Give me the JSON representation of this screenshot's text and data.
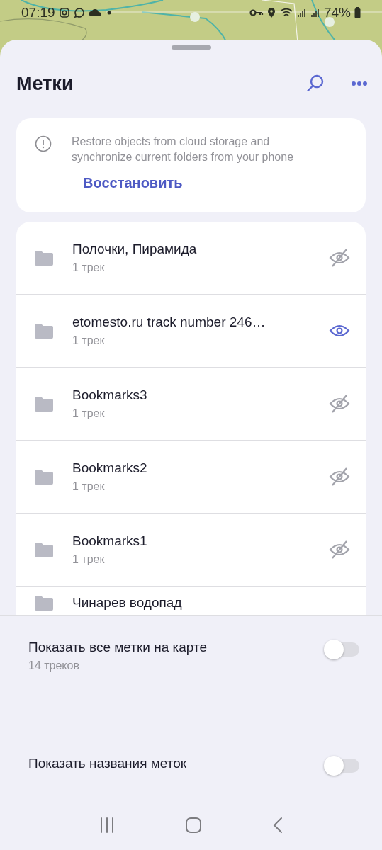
{
  "status_bar": {
    "time": "07:19",
    "battery": "74%"
  },
  "header": {
    "title": "Метки"
  },
  "sync_card": {
    "message": "Restore objects from cloud storage and synchronize current folders from your phone",
    "action": "Восстановить"
  },
  "lists": [
    {
      "name": "Полочки, Пирамида",
      "count": "1 трек",
      "visible": false
    },
    {
      "name": "etomesto.ru track number 246…",
      "count": "1 трек",
      "visible": true
    },
    {
      "name": "Bookmarks3",
      "count": "1 трек",
      "visible": false
    },
    {
      "name": "Bookmarks2",
      "count": "1 трек",
      "visible": false
    },
    {
      "name": "Bookmarks1",
      "count": "1 трек",
      "visible": false
    },
    {
      "name": "Чинарев водопад"
    }
  ],
  "settings": [
    {
      "label": "Показать все метки на карте",
      "detail": "14 треков",
      "on": false
    },
    {
      "label": "Показать названия меток",
      "on": false
    }
  ]
}
